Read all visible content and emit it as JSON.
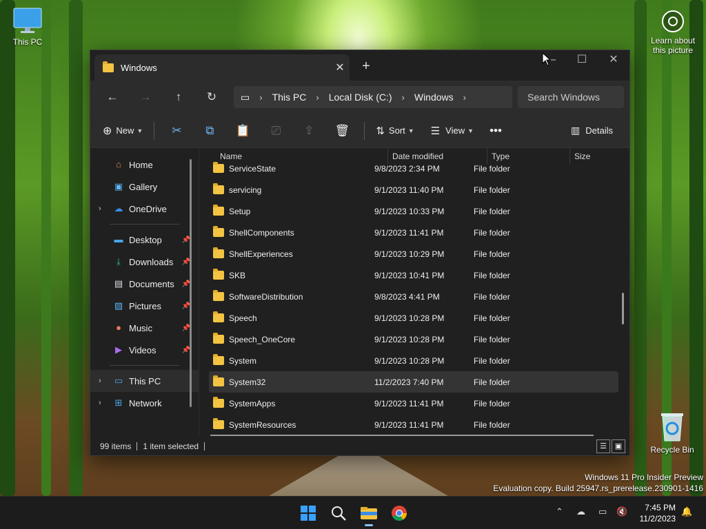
{
  "desktop": {
    "icons": [
      {
        "label": "This PC"
      },
      {
        "label": "Recycle Bin"
      }
    ],
    "learn_about": "Learn about this picture",
    "watermark": {
      "line1": "Windows 11 Pro Insider Preview",
      "line2": "Evaluation copy. Build 25947.rs_prerelease.230901-1416"
    }
  },
  "window": {
    "tab_title": "Windows",
    "search_placeholder": "Search Windows",
    "breadcrumb": [
      "This PC",
      "Local Disk (C:)",
      "Windows"
    ],
    "toolbar": {
      "new_label": "New",
      "sort_label": "Sort",
      "view_label": "View",
      "details_label": "Details"
    },
    "sidebar": {
      "top": [
        {
          "label": "Home",
          "icon": "home-icon"
        },
        {
          "label": "Gallery",
          "icon": "gallery-icon"
        },
        {
          "label": "OneDrive",
          "icon": "cloud-icon"
        }
      ],
      "quick": [
        {
          "label": "Desktop",
          "icon": "desktop-icon"
        },
        {
          "label": "Downloads",
          "icon": "download-icon"
        },
        {
          "label": "Documents",
          "icon": "document-icon"
        },
        {
          "label": "Pictures",
          "icon": "picture-icon"
        },
        {
          "label": "Music",
          "icon": "music-icon"
        },
        {
          "label": "Videos",
          "icon": "video-icon"
        }
      ],
      "bottom": [
        {
          "label": "This PC",
          "icon": "pc-icon"
        },
        {
          "label": "Network",
          "icon": "network-icon"
        }
      ]
    },
    "columns": {
      "name": "Name",
      "date": "Date modified",
      "type": "Type",
      "size": "Size"
    },
    "files": [
      {
        "name": "ServiceState",
        "date": "9/8/2023 2:34 PM",
        "type": "File folder"
      },
      {
        "name": "servicing",
        "date": "9/1/2023 11:40 PM",
        "type": "File folder"
      },
      {
        "name": "Setup",
        "date": "9/1/2023 10:33 PM",
        "type": "File folder"
      },
      {
        "name": "ShellComponents",
        "date": "9/1/2023 11:41 PM",
        "type": "File folder"
      },
      {
        "name": "ShellExperiences",
        "date": "9/1/2023 10:29 PM",
        "type": "File folder"
      },
      {
        "name": "SKB",
        "date": "9/1/2023 10:41 PM",
        "type": "File folder"
      },
      {
        "name": "SoftwareDistribution",
        "date": "9/8/2023 4:41 PM",
        "type": "File folder"
      },
      {
        "name": "Speech",
        "date": "9/1/2023 10:28 PM",
        "type": "File folder"
      },
      {
        "name": "Speech_OneCore",
        "date": "9/1/2023 10:28 PM",
        "type": "File folder"
      },
      {
        "name": "System",
        "date": "9/1/2023 10:28 PM",
        "type": "File folder"
      },
      {
        "name": "System32",
        "date": "11/2/2023 7:40 PM",
        "type": "File folder"
      },
      {
        "name": "SystemApps",
        "date": "9/1/2023 11:41 PM",
        "type": "File folder"
      },
      {
        "name": "SystemResources",
        "date": "9/1/2023 11:41 PM",
        "type": "File folder"
      }
    ],
    "status": {
      "items": "99 items",
      "selected": "1 item selected"
    }
  },
  "taskbar": {
    "time": "7:45 PM",
    "date": "11/2/2023"
  },
  "colors": {
    "accent": "#0078d4",
    "folder": "#f3c442",
    "window_bg": "#202020"
  }
}
